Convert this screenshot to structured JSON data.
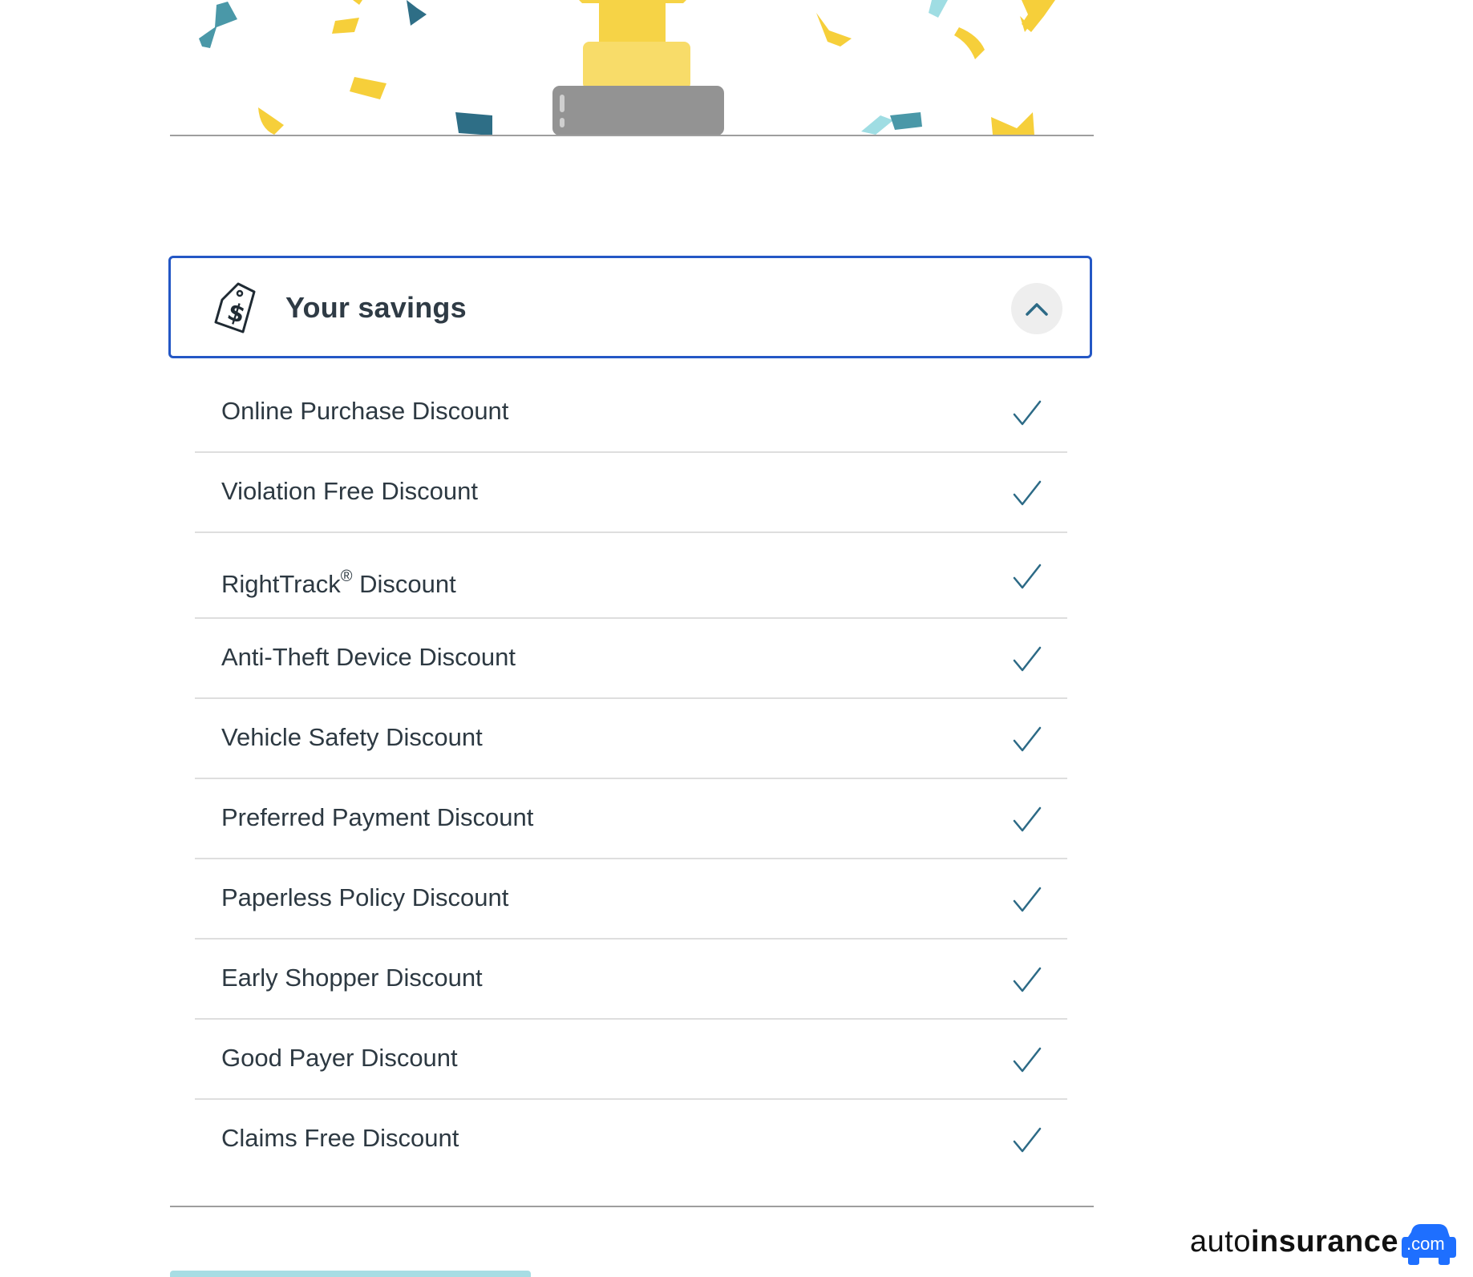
{
  "accordion": {
    "title": "Your savings",
    "expanded": true,
    "icon": "price-tag-dollar-icon",
    "toggle_icon": "chevron-up-icon",
    "border_color": "#2457c5"
  },
  "discounts": [
    {
      "label": "Online Purchase Discount",
      "applied": true
    },
    {
      "label": "Violation Free Discount",
      "applied": true
    },
    {
      "label": "RightTrack",
      "suffix": " Discount",
      "mark": "®",
      "applied": true
    },
    {
      "label": "Anti-Theft Device Discount",
      "applied": true
    },
    {
      "label": "Vehicle Safety Discount",
      "applied": true
    },
    {
      "label": "Preferred Payment Discount",
      "applied": true
    },
    {
      "label": "Paperless Policy Discount",
      "applied": true
    },
    {
      "label": "Early Shopper Discount",
      "applied": true
    },
    {
      "label": "Good Payer Discount",
      "applied": true
    },
    {
      "label": "Claims Free Discount",
      "applied": true
    }
  ],
  "watermark": {
    "brand_light": "auto",
    "brand_bold": "insurance",
    "badge": ".com",
    "badge_color": "#1e6fff"
  },
  "colors": {
    "check": "#2c6a86",
    "confetti_yellow": "#f5cf3a",
    "confetti_teal": "#3f8fa3",
    "trophy_base": "#939393"
  }
}
